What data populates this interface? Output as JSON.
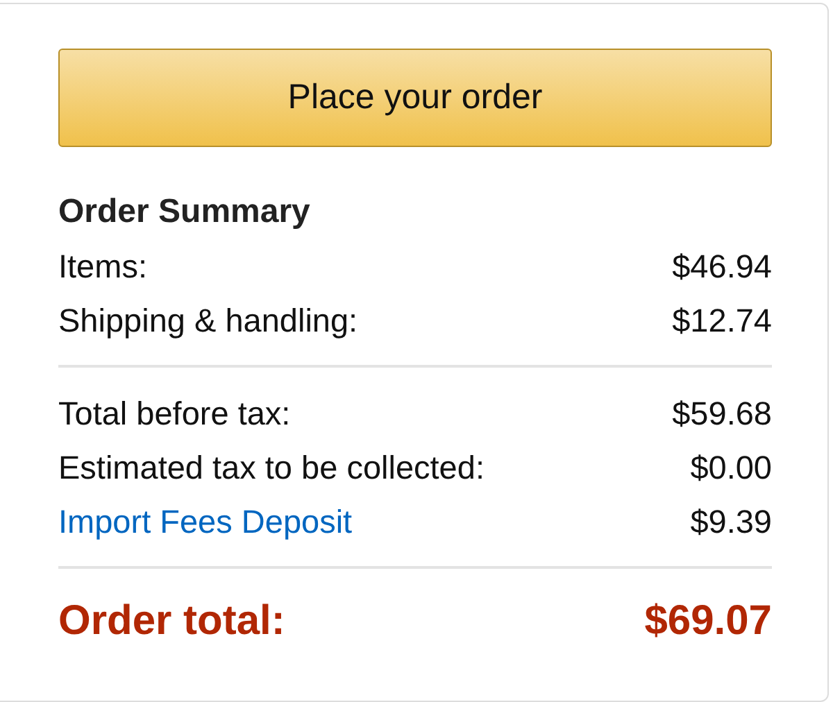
{
  "order_button": {
    "label": "Place your order"
  },
  "summary": {
    "title": "Order Summary",
    "groups": [
      {
        "rows": [
          {
            "kind": "plain",
            "label": "Items:",
            "amount": "$46.94"
          },
          {
            "kind": "plain",
            "label": "Shipping & handling:",
            "amount": "$12.74"
          }
        ]
      },
      {
        "rows": [
          {
            "kind": "plain",
            "label": "Total before tax:",
            "amount": "$59.68"
          },
          {
            "kind": "plain",
            "label": "Estimated tax to be collected:",
            "amount": "$0.00"
          },
          {
            "kind": "link",
            "label": "Import Fees Deposit",
            "amount": "$9.39"
          }
        ]
      }
    ],
    "total": {
      "label": "Order total:",
      "amount": "$69.07"
    }
  }
}
